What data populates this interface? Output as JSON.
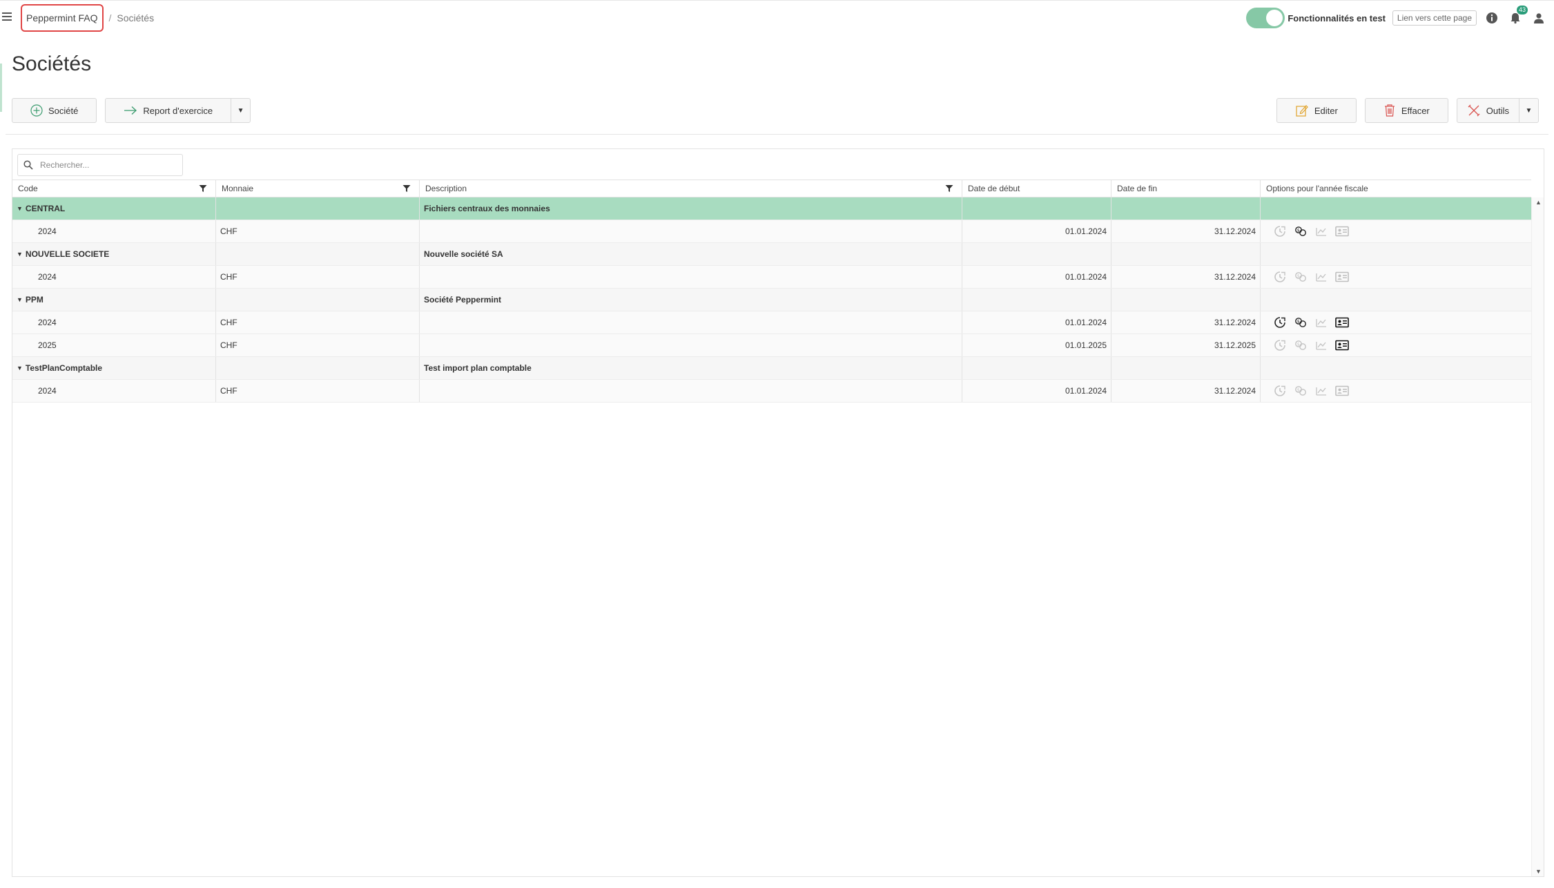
{
  "breadcrumb": {
    "home": "Peppermint FAQ",
    "current": "Sociétés"
  },
  "header": {
    "feature_toggle_label": "Fonctionnalités en test",
    "page_link": "Lien vers cette page",
    "notification_count": "43"
  },
  "page": {
    "title": "Sociétés"
  },
  "toolbar": {
    "add_company": "Société",
    "carry_forward": "Report d'exercice",
    "edit": "Editer",
    "delete": "Effacer",
    "tools": "Outils"
  },
  "search": {
    "placeholder": "Rechercher..."
  },
  "table": {
    "columns": [
      "Code",
      "Monnaie",
      "Description",
      "Date de début",
      "Date de fin",
      "Options pour l'année fiscale"
    ],
    "groups": [
      {
        "code": "CENTRAL",
        "description": "Fichiers centraux des monnaies",
        "selected": true,
        "years": [
          {
            "year": "2024",
            "currency": "CHF",
            "start": "01.01.2024",
            "end": "31.12.2024",
            "options": [
              false,
              true,
              false,
              false
            ]
          }
        ]
      },
      {
        "code": "NOUVELLE SOCIETE",
        "description": "Nouvelle société SA",
        "selected": false,
        "years": [
          {
            "year": "2024",
            "currency": "CHF",
            "start": "01.01.2024",
            "end": "31.12.2024",
            "options": [
              false,
              false,
              false,
              false
            ]
          }
        ]
      },
      {
        "code": "PPM",
        "description": "Société Peppermint",
        "selected": false,
        "years": [
          {
            "year": "2024",
            "currency": "CHF",
            "start": "01.01.2024",
            "end": "31.12.2024",
            "options": [
              true,
              true,
              false,
              true
            ]
          },
          {
            "year": "2025",
            "currency": "CHF",
            "start": "01.01.2025",
            "end": "31.12.2025",
            "options": [
              false,
              false,
              false,
              true
            ]
          }
        ]
      },
      {
        "code": "TestPlanComptable",
        "description": "Test import plan comptable",
        "selected": false,
        "years": [
          {
            "year": "2024",
            "currency": "CHF",
            "start": "01.01.2024",
            "end": "31.12.2024",
            "options": [
              false,
              false,
              false,
              false
            ]
          }
        ]
      }
    ]
  },
  "colors": {
    "accent": "#86c8a6",
    "selected_row": "#a8dcc0",
    "badge": "#2a9d7a",
    "delete": "#d9534f",
    "edit": "#e0a22a"
  }
}
